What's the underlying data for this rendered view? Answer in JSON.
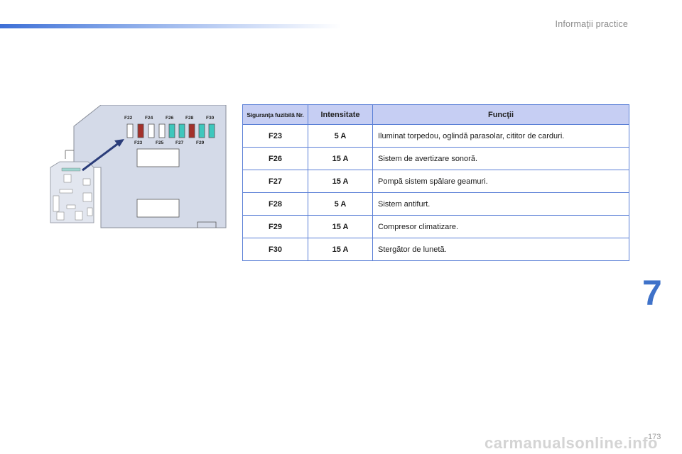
{
  "header": {
    "section_title": "Informaţii practice"
  },
  "chapter": "7",
  "page_number": "173",
  "watermark": "carmanualsonline.info",
  "diagram": {
    "top_labels": [
      "F22",
      "F24",
      "F26",
      "F28",
      "F30"
    ],
    "bottom_labels": [
      "F23",
      "F25",
      "F27",
      "F29"
    ],
    "colors": {
      "red_fuse": "#a3312b",
      "teal_fuse": "#3ec7bd",
      "clear_fuse": "#ffffff",
      "panel": "#cfd6e6",
      "arrow": "#2b3d7a"
    }
  },
  "table": {
    "headers": [
      "Siguranţa fuzibilă Nr.",
      "Intensitate",
      "Funcţii"
    ],
    "rows": [
      [
        "F23",
        "5 A",
        "Iluminat torpedou, oglindă parasolar, cititor de carduri."
      ],
      [
        "F26",
        "15 A",
        "Sistem de avertizare sonoră."
      ],
      [
        "F27",
        "15 A",
        "Pompă sistem spălare geamuri."
      ],
      [
        "F28",
        "5 A",
        "Sistem antifurt."
      ],
      [
        "F29",
        "15 A",
        "Compresor climatizare."
      ],
      [
        "F30",
        "15 A",
        "Stergător de lunetă."
      ]
    ]
  }
}
